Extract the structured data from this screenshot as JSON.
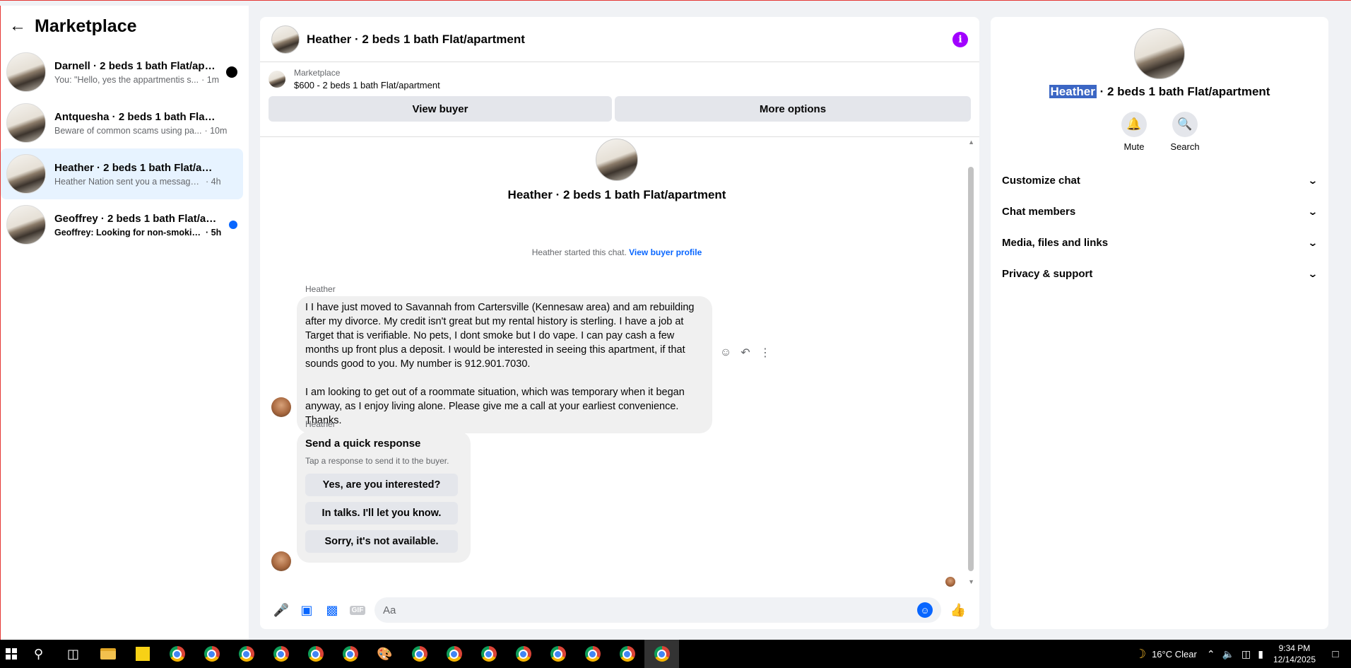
{
  "sidebar": {
    "title": "Marketplace",
    "conversations": [
      {
        "name": "Darnell · 2 beds 1 bath Flat/apar...",
        "snippet": "You: \"Hello, yes the appartmentis s...",
        "time": "· 1m"
      },
      {
        "name": "Antquesha · 2 beds 1 bath Flat/apa...",
        "snippet": "Beware of common scams using pa...",
        "time": "· 10m"
      },
      {
        "name": "Heather · 2 beds 1 bath Flat/apart...",
        "snippet": "Heather Nation sent you a message a...",
        "time": "· 4h"
      },
      {
        "name": "Geoffrey · 2 beds 1 bath Flat/apa...",
        "snippet": "Geoffrey: Looking for non-smokin...",
        "time": "· 5h"
      }
    ]
  },
  "chat": {
    "title": "Heather · 2 beds 1 bath Flat/apartment",
    "listing": {
      "source": "Marketplace",
      "price_title": "$600 - 2 beds 1 bath Flat/apartment",
      "view_buyer": "View buyer",
      "more_options": "More options"
    },
    "intro_name": "Heather · 2 beds 1 bath Flat/apartment",
    "started_text": "Heather started this chat.",
    "view_profile": "View buyer profile",
    "message1": {
      "sender": "Heather",
      "text": "I I have just moved to Savannah from Cartersville (Kennesaw area) and am rebuilding\nafter my divorce. My credit isn't great but my rental history is sterling. I have a job at\nTarget that is verifiable. No pets, I dont smoke but I do vape. I can pay cash a few\nmonths up front plus a deposit. I would be interested in seeing this apartment, if that\nsounds good to you. My number is 912.901.7030.\n\nI am looking to get out of a roommate situation, which was temporary when it began\nanyway, as I enjoy living alone. Please give me a call at your earliest convenience.\nThanks."
    },
    "message2": {
      "sender": "Heather",
      "title": "Send a quick response",
      "subtitle": "Tap a response to send it to the buyer.",
      "options": [
        "Yes, are you interested?",
        "In talks. I'll let you know.",
        "Sorry, it's not available."
      ]
    },
    "composer_placeholder": "Aa"
  },
  "info_panel": {
    "name_highlight": "Heather",
    "name_rest": " · 2 beds 1 bath Flat/apartment",
    "actions": [
      {
        "label": "Mute",
        "icon": "bell-icon"
      },
      {
        "label": "Search",
        "icon": "search-icon"
      }
    ],
    "sections": [
      "Customize chat",
      "Chat members",
      "Media, files and links",
      "Privacy & support"
    ]
  },
  "taskbar": {
    "weather": "16°C  Clear",
    "time": "9:34 PM",
    "date": "12/14/2025"
  },
  "colors": {
    "accent": "#0866ff",
    "info_icon": "#a100ff",
    "active_row": "#e7f3ff",
    "highlight": "#3b66c4"
  }
}
